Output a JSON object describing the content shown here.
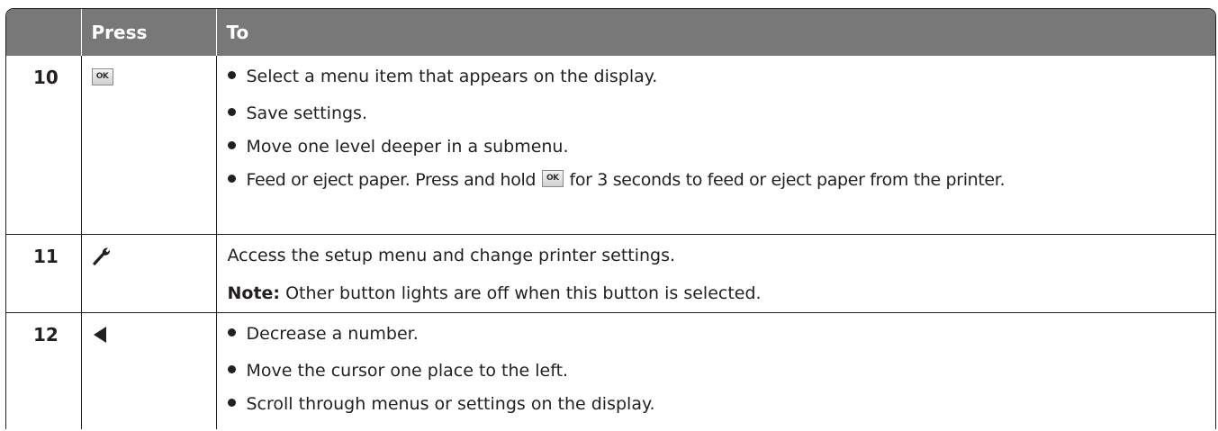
{
  "header": {
    "col1": "",
    "col2": "Press",
    "col3": "To"
  },
  "rows": [
    {
      "number": "10",
      "key_icon": "ok-button-icon",
      "bullets": [
        "Select a menu item that appears on the display.",
        "Save settings.",
        "Move one level deeper in a submenu."
      ],
      "last_bullet": {
        "before": "Feed or eject paper. Press and hold ",
        "icon": "ok-button-icon",
        "after": " for 3 seconds to feed or eject paper from the printer."
      }
    },
    {
      "number": "11",
      "key_icon": "wrench-icon",
      "line1": "Access the setup menu and change printer settings.",
      "note_label": "Note:",
      "note_text": " Other button lights are off when this button is selected."
    },
    {
      "number": "12",
      "key_icon": "left-arrow-icon",
      "bullets": [
        "Decrease a number.",
        "Move the cursor one place to the left.",
        "Scroll through menus or settings on the display."
      ]
    }
  ],
  "icon_text": {
    "ok": "OK"
  },
  "colors": {
    "header_bg": "#787878",
    "header_text": "#ffffff",
    "text": "#231f20"
  }
}
